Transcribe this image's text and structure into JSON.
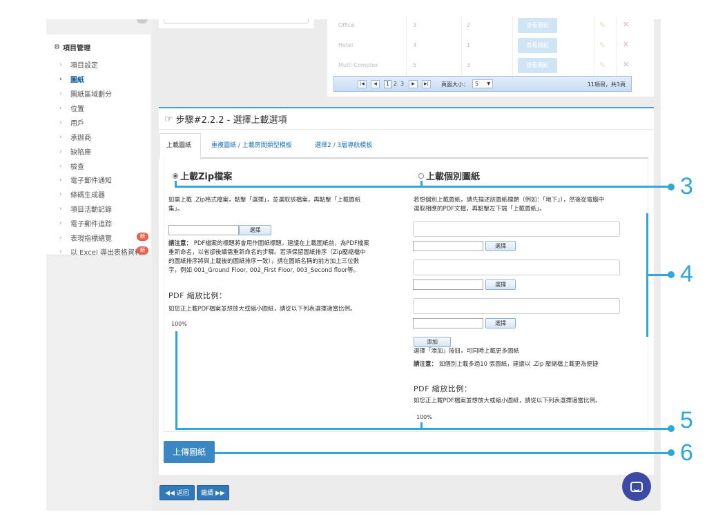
{
  "sidebar": {
    "section_title": "項目管理",
    "items": [
      {
        "label": "項目設定",
        "active": false,
        "badge": ""
      },
      {
        "label": "圖紙",
        "active": true,
        "badge": ""
      },
      {
        "label": "圖紙區域劃分",
        "active": false,
        "badge": ""
      },
      {
        "label": "位置",
        "active": false,
        "badge": ""
      },
      {
        "label": "用戶",
        "active": false,
        "badge": ""
      },
      {
        "label": "承辦商",
        "active": false,
        "badge": ""
      },
      {
        "label": "缺陷庫",
        "active": false,
        "badge": ""
      },
      {
        "label": "檢查",
        "active": false,
        "badge": ""
      },
      {
        "label": "電子郵件通知",
        "active": false,
        "badge": ""
      },
      {
        "label": "條碼生成器",
        "active": false,
        "badge": ""
      },
      {
        "label": "項目活動記錄",
        "active": false,
        "badge": ""
      },
      {
        "label": "電子郵件追踪",
        "active": false,
        "badge": ""
      },
      {
        "label": "表現指標總覽",
        "active": false,
        "badge": "新"
      },
      {
        "label": "以 Excel 導出表格資料",
        "active": false,
        "badge": "新"
      }
    ]
  },
  "room_table": {
    "rows": [
      {
        "name": "Office",
        "col2": "3",
        "col3": "2",
        "action": "查看圖紙"
      },
      {
        "name": "Hotel",
        "col2": "4",
        "col3": "1",
        "action": "查看圖紙"
      },
      {
        "name": "Multi-Complex",
        "col2": "5",
        "col3": "3",
        "action": "查看圖紙"
      }
    ],
    "pager": {
      "pages": [
        "1",
        "2",
        "3"
      ],
      "page_size_label": "頁面大小：",
      "page_size": "5",
      "summary": "11項目，共3頁"
    }
  },
  "step": {
    "title": "步驟#2.2.2 - 選擇上載選項",
    "tabs": [
      "上載圖紙",
      "重複圖紙 / 上載房間類型模板",
      "選擇2 / 3層導航模板"
    ],
    "zip": {
      "heading": "上載Zip檔案",
      "desc_line1": "如需上載 .Zip格式檔案，點擊「選擇」，並選取該檔案，再點擊「上載圖紙",
      "desc_line2": "集」。",
      "choose": "選擇",
      "note_label": "請注意：",
      "note_line1": "PDF檔案的標題將會用作圖紙標題。建議在上載圖紙前，為PDF檔案",
      "note_line2": "重新命名，以省卻後續需重新命名的步驟。若須保留圖紙排序（Zip壓縮檔中",
      "note_line3": "的圖紙排序將與上載後的圖紙排序一致），請在圖紙名稱的前方加上三位數",
      "note_line4": "字，例如 001_Ground Floor, 002_First Floor, 003_Second floor等。",
      "scale_title": "PDF 縮放比例：",
      "scale_desc": "如您正上載PDF檔案並想放大或縮小圖紙，請從以下列表選擇適當比例。",
      "scale_value": "100%"
    },
    "single": {
      "heading": "上載個別圖紙",
      "desc_line1": "若想個別上載圖紙，請先描述該圖紙標題（例如：「地下」），然後從電腦中",
      "desc_line2": "選取相應的PDF文檔，再點擊左下端「上載圖紙」。",
      "choose": "選擇",
      "add": "添加",
      "add_hint": "選擇「添加」按鈕，可同時上載更多圖紙",
      "note_label": "請注意：",
      "note": "如個別上載多過10 張圖紙，建議以 .Zip 壓縮檔上載更為便捷",
      "scale_title": "PDF 縮放比例：",
      "scale_desc": "如您正上載PDF檔案並想放大或縮小圖紙，請從以下列表選擇適當比例。",
      "scale_value": "100%"
    },
    "upload_button": "上傳圖紙"
  },
  "footer_nav": {
    "back": "返回",
    "next": "繼續"
  },
  "callouts": [
    "3",
    "4",
    "5",
    "6"
  ],
  "colors": {
    "accent": "#2fa6dc",
    "primary_button": "#3b87c3",
    "new_badge": "#e8604c",
    "chat": "#3c4aa5"
  }
}
